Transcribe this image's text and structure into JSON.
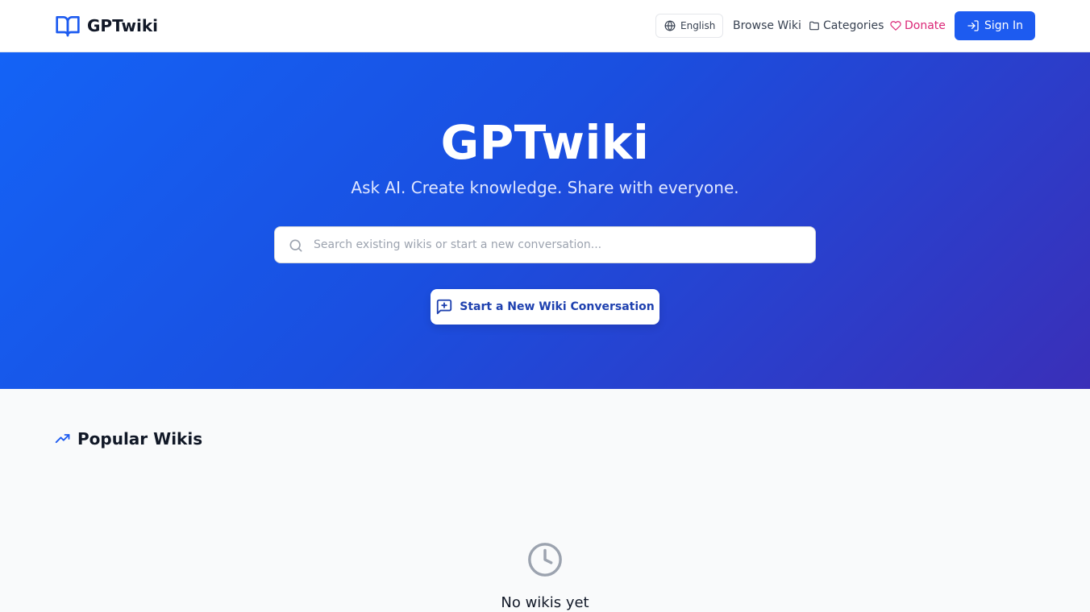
{
  "header": {
    "logo_text": "GPTwiki",
    "language": "English",
    "nav": {
      "browse": "Browse Wiki",
      "categories": "Categories",
      "donate": "Donate"
    },
    "sign_in": "Sign In"
  },
  "hero": {
    "title": "GPTwiki",
    "subtitle": "Ask AI. Create knowledge. Share with everyone.",
    "search_placeholder": "Search existing wikis or start a new conversation...",
    "new_conversation_button": "Start a New Wiki Conversation"
  },
  "popular": {
    "heading": "Popular Wikis",
    "empty_message": "No wikis yet"
  },
  "icons": {
    "logo": "book-open-icon",
    "language": "globe-icon",
    "categories": "folder-icon",
    "donate": "heart-icon",
    "sign_in": "log-in-icon",
    "search": "search-icon",
    "new_conversation": "message-square-plus-icon",
    "popular": "trending-up-icon",
    "empty": "clock-icon"
  },
  "colors": {
    "primary": "#1d5bf0",
    "hero_gradient_start": "#1463f6",
    "hero_gradient_end": "#3a2fb8",
    "donate": "#db2777"
  }
}
